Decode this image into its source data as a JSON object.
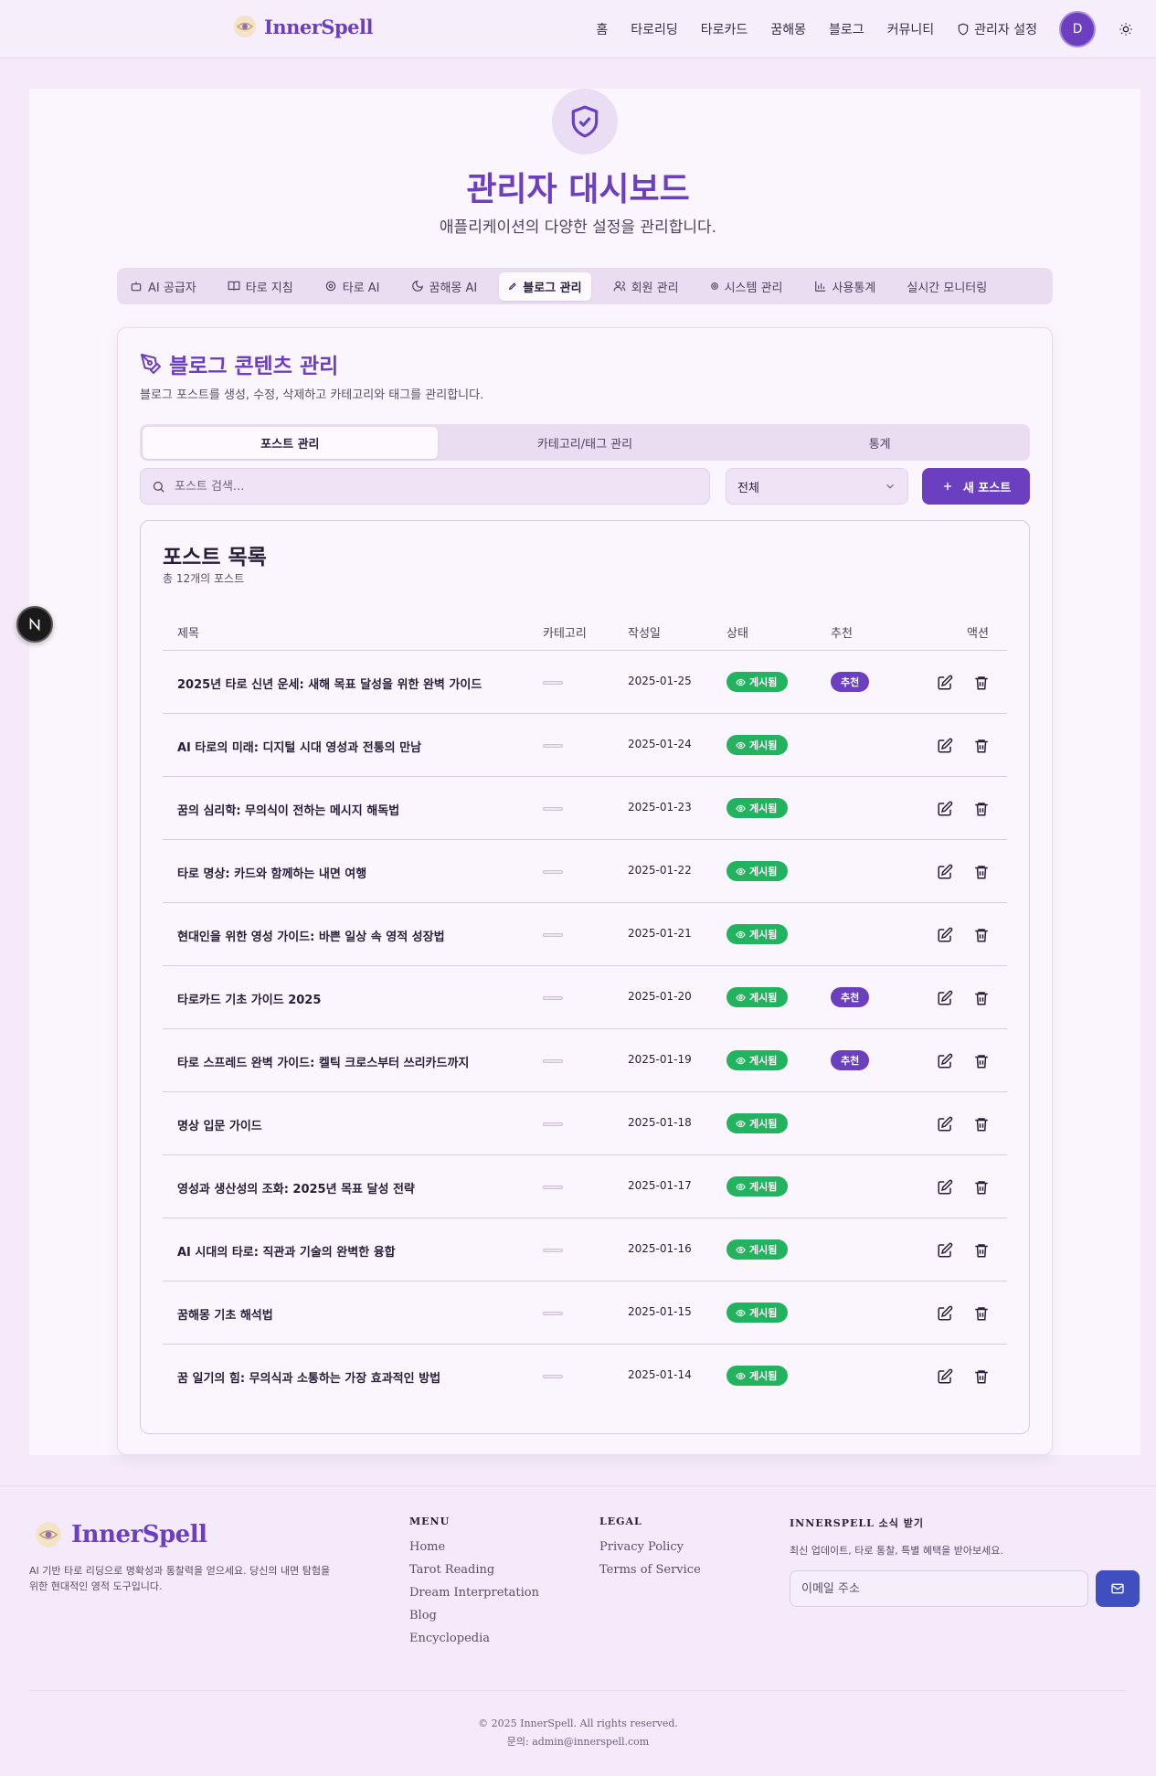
{
  "header": {
    "brand": "InnerSpell",
    "nav": [
      "홈",
      "타로리딩",
      "타로카드",
      "꿈해몽",
      "블로그",
      "커뮤니티"
    ],
    "admin_label": "관리자 설정",
    "avatar_initial": "D"
  },
  "hero": {
    "title": "관리자 대시보드",
    "subtitle": "애플리케이션의 다양한 설정을 관리합니다."
  },
  "admin_tabs": [
    {
      "label": "AI 공급자",
      "icon": "bot-icon"
    },
    {
      "label": "타로 지침",
      "icon": "book-icon"
    },
    {
      "label": "타로 AI",
      "icon": "cog-icon"
    },
    {
      "label": "꿈해몽 AI",
      "icon": "moon-icon"
    },
    {
      "label": "블로그 관리",
      "icon": "pen-icon",
      "active": true
    },
    {
      "label": "회원 관리",
      "icon": "users-icon"
    },
    {
      "label": "시스템 관리",
      "icon": "system-icon"
    },
    {
      "label": "사용통계",
      "icon": "chart-icon"
    },
    {
      "label": "실시간 모니터링",
      "icon": "monitor-icon"
    }
  ],
  "blog": {
    "title": "블로그 콘텐츠 관리",
    "description": "블로그 포스트를 생성, 수정, 삭제하고 카테고리와 태그를 관리합니다.",
    "subtabs": [
      "포스트 관리",
      "카테고리/태그 관리",
      "통계"
    ],
    "search_placeholder": "포스트 검색...",
    "filter_value": "전체",
    "new_post_label": "새 포스트"
  },
  "post_list": {
    "title": "포스트 목록",
    "count_text": "총 12개의 포스트",
    "columns": [
      "제목",
      "카테고리",
      "작성일",
      "상태",
      "추천",
      "액션"
    ],
    "status_label": "게시됨",
    "featured_label": "추천",
    "rows": [
      {
        "title": "2025년 타로 신년 운세: 새해 목표 달성을 위한 완벽 가이드",
        "date": "2025-01-25",
        "featured": true
      },
      {
        "title": "AI 타로의 미래: 디지털 시대 영성과 전통의 만남",
        "date": "2025-01-24",
        "featured": false
      },
      {
        "title": "꿈의 심리학: 무의식이 전하는 메시지 해독법",
        "date": "2025-01-23",
        "featured": false
      },
      {
        "title": "타로 명상: 카드와 함께하는 내면 여행",
        "date": "2025-01-22",
        "featured": false
      },
      {
        "title": "현대인을 위한 영성 가이드: 바쁜 일상 속 영적 성장법",
        "date": "2025-01-21",
        "featured": false
      },
      {
        "title": "타로카드 기초 가이드 2025",
        "date": "2025-01-20",
        "featured": true
      },
      {
        "title": "타로 스프레드 완벽 가이드: 켈틱 크로스부터 쓰리카드까지",
        "date": "2025-01-19",
        "featured": true
      },
      {
        "title": "명상 입문 가이드",
        "date": "2025-01-18",
        "featured": false
      },
      {
        "title": "영성과 생산성의 조화: 2025년 목표 달성 전략",
        "date": "2025-01-17",
        "featured": false
      },
      {
        "title": "AI 시대의 타로: 직관과 기술의 완벽한 융합",
        "date": "2025-01-16",
        "featured": false
      },
      {
        "title": "꿈해몽 기초 해석법",
        "date": "2025-01-15",
        "featured": false
      },
      {
        "title": "꿈 일기의 힘: 무의식과 소통하는 가장 효과적인 방법",
        "date": "2025-01-14",
        "featured": false
      }
    ]
  },
  "footer": {
    "brand": "InnerSpell",
    "description": "AI 기반 타로 리딩으로 명확성과 통찰력을 얻으세요. 당신의 내면 탐험을 위한 현대적인 영적 도구입니다.",
    "menu_heading": "MENU",
    "menu_links": [
      "Home",
      "Tarot Reading",
      "Dream Interpretation",
      "Blog",
      "Encyclopedia"
    ],
    "legal_heading": "LEGAL",
    "legal_links": [
      "Privacy Policy",
      "Terms of Service"
    ],
    "news_heading": "INNERSPELL 소식 받기",
    "news_desc": "최신 업데이트, 타로 통찰, 특별 혜택을 받아보세요.",
    "email_placeholder": "이메일 주소",
    "copyright": "© 2025 InnerSpell. All rights reserved.",
    "contact": "문의: admin@innerspell.com"
  },
  "colors": {
    "brand": "#6b3fbf",
    "published": "#22b35e",
    "background": "#f4eaf9"
  }
}
